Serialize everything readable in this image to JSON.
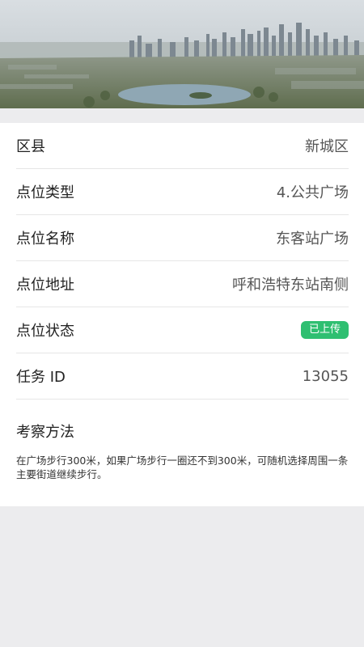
{
  "header": {
    "image": "city-skyline-banner"
  },
  "details": [
    {
      "label": "区县",
      "value": "新城区"
    },
    {
      "label": "点位类型",
      "value": "4.公共广场"
    },
    {
      "label": "点位名称",
      "value": "东客站广场"
    },
    {
      "label": "点位地址",
      "value": "呼和浩特东站南侧"
    },
    {
      "label": "点位状态",
      "value": "已上传",
      "badge_color": "#2fbf71"
    },
    {
      "label": "任务 ID",
      "value": "13055"
    }
  ],
  "method": {
    "title": "考察方法",
    "text": "在广场步行300米，如果广场步行一圈还不到300米，可随机选择周围一条主要街道继续步行。"
  }
}
